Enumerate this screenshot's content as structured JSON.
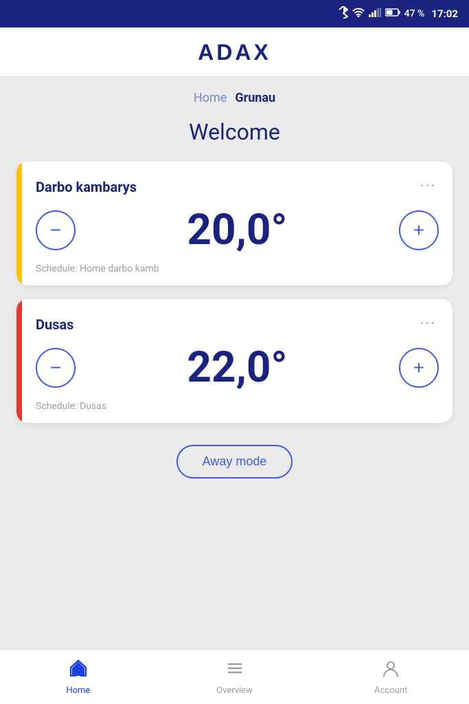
{
  "statusBar": {
    "battery": "47 %",
    "time": "17:02"
  },
  "header": {
    "logo": "ADAX"
  },
  "breadcrumb": {
    "home": "Home",
    "current": "Grunau"
  },
  "welcome": "Welcome",
  "devices": [
    {
      "id": "device-1",
      "name": "Darbo kambarys",
      "temperature": "20,0°",
      "schedule": "Schedule: Home darbo kamb",
      "accent": "yellow"
    },
    {
      "id": "device-2",
      "name": "Dusas",
      "temperature": "22,0°",
      "schedule": "Schedule: Dusas",
      "accent": "red"
    }
  ],
  "awayMode": {
    "label": "Away mode"
  },
  "bottomNav": {
    "items": [
      {
        "id": "home",
        "label": "Home",
        "active": true
      },
      {
        "id": "overview",
        "label": "Overview",
        "active": false
      },
      {
        "id": "account",
        "label": "Account",
        "active": false
      }
    ]
  },
  "icons": {
    "bluetooth": "⬡",
    "wifi": "▲",
    "signal": "▐",
    "battery": "▮"
  }
}
